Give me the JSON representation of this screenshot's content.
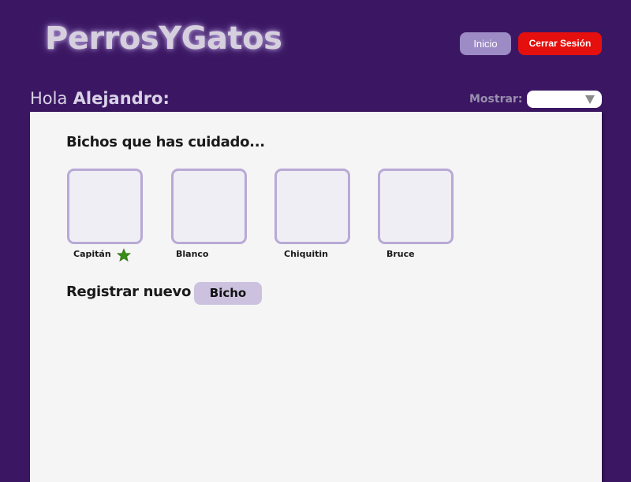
{
  "app": {
    "logo_text": "PerrosYGatos"
  },
  "header": {
    "inicio_label": "Inicio",
    "logout_label": "Cerrar Sesión"
  },
  "greeting": {
    "hola": "Hola",
    "name": "Alejandro:"
  },
  "filter": {
    "label": "Mostrar:",
    "selected": ""
  },
  "main": {
    "section_title": "Bichos que has cuidado...",
    "pets": [
      {
        "name": "Capitán",
        "favorite": true
      },
      {
        "name": "Blanco",
        "favorite": false
      },
      {
        "name": "Chiquitin",
        "favorite": false
      },
      {
        "name": "Bruce",
        "favorite": false
      }
    ],
    "register_label": "Registrar nuevo",
    "register_button": "Bicho"
  },
  "colors": {
    "background": "#3b1763",
    "panel": "#f5f5f5",
    "card_border": "#b8a9d6",
    "inicio_button": "#9c8bc4",
    "logout_button": "#e5100d",
    "bicho_button": "#ccc2df",
    "favorite_star": "#3a8c1a"
  }
}
